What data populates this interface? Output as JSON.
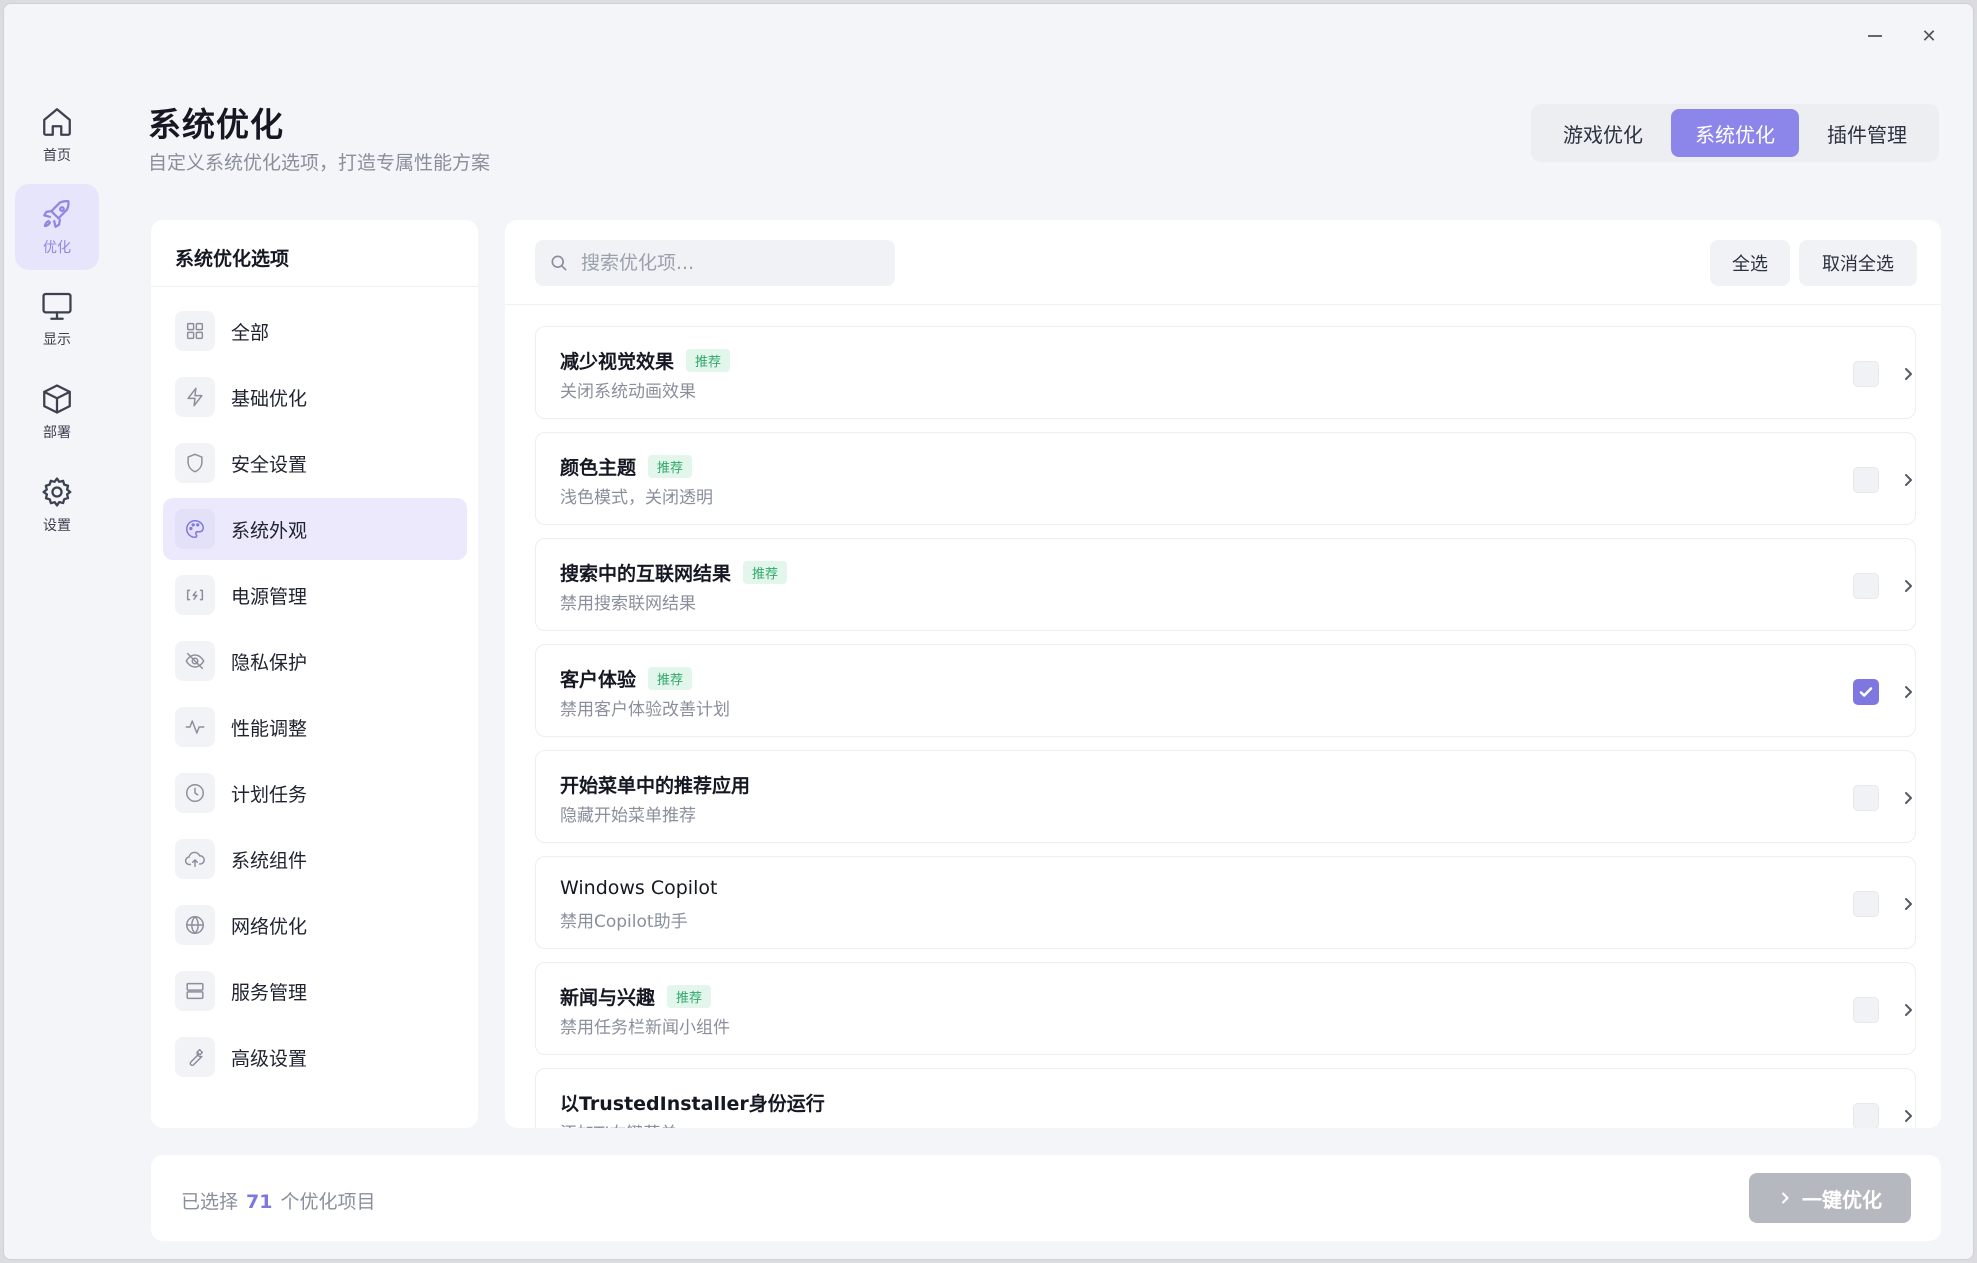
{
  "nav": {
    "items": [
      {
        "label": "首页",
        "icon": "home-icon"
      },
      {
        "label": "优化",
        "icon": "rocket-icon"
      },
      {
        "label": "显示",
        "icon": "monitor-icon"
      },
      {
        "label": "部署",
        "icon": "box-icon"
      },
      {
        "label": "设置",
        "icon": "gear-icon"
      }
    ],
    "active": "优化"
  },
  "header": {
    "title": "系统优化",
    "subtitle": "自定义系统优化选项，打造专属性能方案",
    "tabs": [
      {
        "label": "游戏优化"
      },
      {
        "label": "系统优化"
      },
      {
        "label": "插件管理"
      }
    ],
    "active_tab": "系统优化"
  },
  "categories": {
    "title": "系统优化选项",
    "items": [
      {
        "label": "全部",
        "icon": "grid-icon"
      },
      {
        "label": "基础优化",
        "icon": "lightning-icon"
      },
      {
        "label": "安全设置",
        "icon": "shield-icon"
      },
      {
        "label": "系统外观",
        "icon": "palette-icon"
      },
      {
        "label": "电源管理",
        "icon": "battery-icon"
      },
      {
        "label": "隐私保护",
        "icon": "eye-off-icon"
      },
      {
        "label": "性能调整",
        "icon": "activity-icon"
      },
      {
        "label": "计划任务",
        "icon": "clock-icon"
      },
      {
        "label": "系统组件",
        "icon": "cloud-icon"
      },
      {
        "label": "网络优化",
        "icon": "globe-icon"
      },
      {
        "label": "服务管理",
        "icon": "server-icon"
      },
      {
        "label": "高级设置",
        "icon": "wrench-icon"
      }
    ],
    "active": "系统外观"
  },
  "toolbar": {
    "search_placeholder": "搜索优化项...",
    "select_all": "全选",
    "deselect_all": "取消全选"
  },
  "options": [
    {
      "title": "减少视觉效果",
      "desc": "关闭系统动画效果",
      "badge": "推荐",
      "checked": false
    },
    {
      "title": "颜色主题",
      "desc": "浅色模式，关闭透明",
      "badge": "推荐",
      "checked": false
    },
    {
      "title": "搜索中的互联网结果",
      "desc": "禁用搜索联网结果",
      "badge": "推荐",
      "checked": false
    },
    {
      "title": "客户体验",
      "desc": "禁用客户体验改善计划",
      "badge": "推荐",
      "checked": true
    },
    {
      "title": "开始菜单中的推荐应用",
      "desc": "隐藏开始菜单推荐",
      "badge": "",
      "checked": false
    },
    {
      "title": "Windows Copilot",
      "desc": "禁用Copilot助手",
      "badge": "",
      "checked": false
    },
    {
      "title": "新闻与兴趣",
      "desc": "禁用任务栏新闻小组件",
      "badge": "推荐",
      "checked": false
    },
    {
      "title": "以TrustedInstaller身份运行",
      "desc": "添加TI右键菜单",
      "badge": "",
      "checked": false
    }
  ],
  "footer": {
    "prefix": "已选择",
    "count": "71",
    "suffix": "个优化项目",
    "action": "一键优化"
  },
  "colors": {
    "accent": "#8d86ea",
    "badge_green": "#2fa86a",
    "disabled_button": "#b6b8c0"
  }
}
